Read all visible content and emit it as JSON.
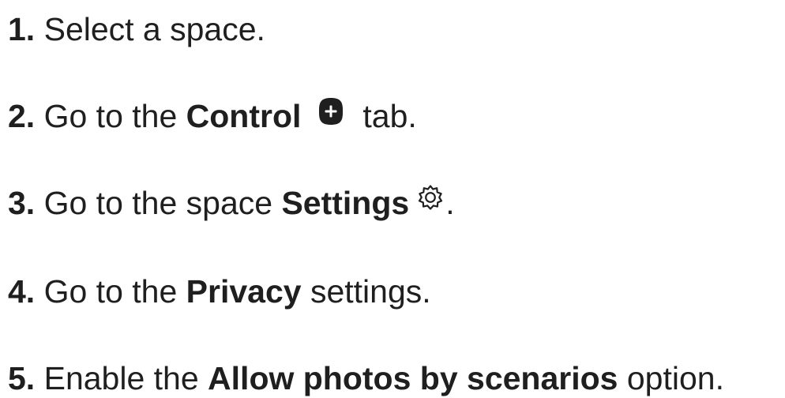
{
  "steps": [
    {
      "number": "1.",
      "text": " Select a space."
    },
    {
      "number": "2.",
      "text_before": " Go to the ",
      "bold": "Control",
      "icon": "plus-icon",
      "text_after": "tab."
    },
    {
      "number": "3.",
      "text_before": " Go to the space ",
      "bold": "Settings",
      "icon": "gear-icon",
      "text_after": "."
    },
    {
      "number": "4.",
      "text_before": " Go to the ",
      "bold": "Privacy",
      "text_after": " settings."
    },
    {
      "number": "5.",
      "text_before": " Enable the ",
      "bold": "Allow photos by scenarios",
      "text_after": " option."
    }
  ],
  "colors": {
    "text": "#1f1f1f",
    "icon": "#1f1f1f"
  }
}
